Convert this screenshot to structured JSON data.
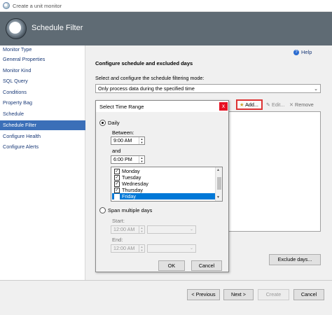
{
  "window": {
    "title": "Create a unit monitor"
  },
  "header": {
    "title": "Schedule Filter"
  },
  "sidebar": {
    "items": [
      {
        "label": "Monitor Type",
        "active": false
      },
      {
        "label": "General Properties",
        "active": false
      },
      {
        "label": "Monitor Kind",
        "active": false
      },
      {
        "label": "SQL Query",
        "active": false
      },
      {
        "label": "Conditions",
        "active": false
      },
      {
        "label": "Property Bag",
        "active": false
      },
      {
        "label": "Schedule",
        "active": false
      },
      {
        "label": "Schedule Filter",
        "active": true
      },
      {
        "label": "Configure Health",
        "active": false
      },
      {
        "label": "Configure Alerts",
        "active": false
      }
    ]
  },
  "main": {
    "help_label": "Help",
    "section_title": "Configure schedule and excluded days",
    "mode_description": "Select and configure the schedule filtering mode:",
    "mode_value": "Only process data during the specified time",
    "toolbar": {
      "add_label": "Add...",
      "edit_label": "Edit...",
      "remove_label": "Remove"
    },
    "exclude_days_label": "Exclude days..."
  },
  "dialog": {
    "title": "Select Time Range",
    "close_glyph": "x",
    "daily_label": "Daily",
    "between_label": "Between:",
    "between_value": "9:00 AM",
    "and_label": "and",
    "and_value": "6:00 PM",
    "days": [
      {
        "label": "Monday",
        "checked": true
      },
      {
        "label": "Tuesday",
        "checked": true
      },
      {
        "label": "Wednesday",
        "checked": true
      },
      {
        "label": "Thursday",
        "checked": true
      },
      {
        "label": "Friday",
        "checked": true
      }
    ],
    "span_label": "Span multiple days",
    "start_label": "Start:",
    "start_value": "12:00 AM",
    "end_label": "End:",
    "end_value": "12:00 AM",
    "ok_label": "OK",
    "cancel_label": "Cancel"
  },
  "footer": {
    "previous_label": "< Previous",
    "next_label": "Next >",
    "create_label": "Create",
    "cancel_label": "Cancel"
  }
}
